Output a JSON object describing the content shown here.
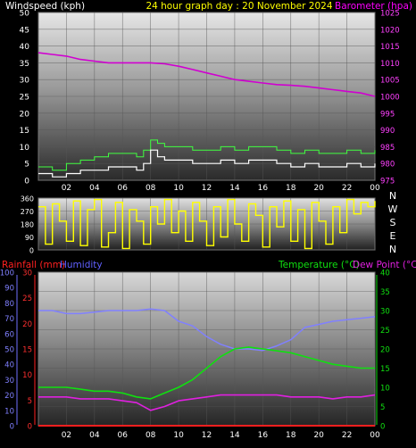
{
  "header": {
    "wind_label": "Windspeed (kph)",
    "title": "24 hour graph day : 20 November 2024",
    "baro_label": "Barometer (hpa)"
  },
  "panel2": {
    "compass": [
      "N",
      "W",
      "S",
      "E",
      "N"
    ]
  },
  "panel3": {
    "rain_label": "Rainfall (mm)",
    "humidity_label": "Humidity",
    "temp_label": "Temperature (°C)",
    "dew_label": "Dew Point (°C)"
  },
  "colors": {
    "wind": "#ffffff",
    "gust": "#40ff40",
    "barometer": "#d000d0",
    "direction": "#ffff00",
    "rain": "#ff2020",
    "humidity": "#8080ff",
    "temperature": "#10e010",
    "dewpoint": "#e020e0",
    "title": "#ffff00"
  },
  "chart_data": [
    {
      "type": "line",
      "title": "24 hour graph day : 20 November 2024",
      "x_ticks": [
        "02",
        "04",
        "06",
        "08",
        "10",
        "12",
        "14",
        "16",
        "18",
        "20",
        "22",
        "00"
      ],
      "xlim": [
        0,
        24
      ],
      "y_left": {
        "label": "Windspeed (kph)",
        "ylim": [
          0,
          50
        ],
        "ticks": [
          "0",
          "5",
          "10",
          "15",
          "20",
          "25",
          "30",
          "35",
          "40",
          "45",
          "50"
        ]
      },
      "y_right": {
        "label": "Barometer (hpa)",
        "ylim": [
          975,
          1025
        ],
        "ticks": [
          "975",
          "980",
          "985",
          "990",
          "995",
          "1000",
          "1005",
          "1010",
          "1015",
          "1020",
          "1025"
        ]
      },
      "series": [
        {
          "name": "Windspeed (kph)",
          "axis": "left",
          "x": [
            0,
            1,
            2,
            3,
            4,
            5,
            6,
            7,
            7.5,
            8,
            8.5,
            9,
            10,
            11,
            12,
            13,
            14,
            15,
            16,
            17,
            18,
            19,
            20,
            21,
            22,
            23,
            24
          ],
          "values": [
            2,
            1,
            2,
            3,
            3,
            4,
            4,
            3,
            5,
            9,
            7,
            6,
            6,
            5,
            5,
            6,
            5,
            6,
            6,
            5,
            4,
            5,
            4,
            4,
            5,
            4,
            5
          ]
        },
        {
          "name": "Gust",
          "axis": "left",
          "x": [
            0,
            1,
            2,
            3,
            4,
            5,
            6,
            7,
            7.5,
            8,
            8.5,
            9,
            10,
            11,
            12,
            13,
            14,
            15,
            16,
            17,
            18,
            19,
            20,
            21,
            22,
            23,
            24
          ],
          "values": [
            4,
            3,
            5,
            6,
            7,
            8,
            8,
            7,
            9,
            12,
            11,
            10,
            10,
            9,
            9,
            10,
            9,
            10,
            10,
            9,
            8,
            9,
            8,
            8,
            9,
            8,
            9
          ]
        },
        {
          "name": "Barometer (hpa)",
          "axis": "right",
          "x": [
            0,
            1,
            2,
            3,
            4,
            5,
            6,
            7,
            8,
            9,
            10,
            11,
            12,
            13,
            14,
            15,
            16,
            17,
            18,
            19,
            20,
            21,
            22,
            23,
            24
          ],
          "values": [
            1013,
            1012.5,
            1012,
            1011,
            1010.5,
            1010,
            1010,
            1010,
            1010,
            1009.7,
            1009,
            1008,
            1007,
            1006,
            1005,
            1004.5,
            1004,
            1003.5,
            1003.3,
            1003,
            1002.5,
            1002,
            1001.5,
            1001,
            1000
          ]
        }
      ]
    },
    {
      "type": "line",
      "x_ticks": [
        "02",
        "04",
        "06",
        "08",
        "10",
        "12",
        "14",
        "16",
        "18",
        "20",
        "22",
        "00"
      ],
      "xlim": [
        0,
        24
      ],
      "y_left": {
        "ylim": [
          0,
          360
        ],
        "ticks": [
          "0",
          "90",
          "180",
          "270",
          "360"
        ]
      },
      "series": [
        {
          "name": "Wind direction",
          "axis": "left",
          "x": [
            0,
            0.5,
            1,
            1.5,
            2,
            2.5,
            3,
            3.5,
            4,
            4.5,
            5,
            5.5,
            6,
            6.5,
            7,
            7.5,
            8,
            8.5,
            9,
            9.5,
            10,
            10.5,
            11,
            11.5,
            12,
            12.5,
            13,
            13.5,
            14,
            14.5,
            15,
            15.5,
            16,
            16.5,
            17,
            17.5,
            18,
            18.5,
            19,
            19.5,
            20,
            20.5,
            21,
            21.5,
            22,
            22.5,
            23,
            23.5,
            24
          ],
          "values": [
            300,
            40,
            320,
            200,
            60,
            340,
            30,
            280,
            350,
            20,
            120,
            330,
            10,
            280,
            200,
            40,
            300,
            180,
            350,
            120,
            270,
            60,
            330,
            200,
            30,
            300,
            90,
            350,
            180,
            60,
            320,
            240,
            20,
            300,
            160,
            340,
            60,
            280,
            10,
            330,
            200,
            40,
            300,
            120,
            350,
            250,
            330,
            300,
            340
          ]
        }
      ]
    },
    {
      "type": "line",
      "x_ticks": [
        "02",
        "04",
        "06",
        "08",
        "10",
        "12",
        "14",
        "16",
        "18",
        "20",
        "22",
        "00"
      ],
      "xlim": [
        0,
        24
      ],
      "y_left": {
        "label": "Humidity",
        "ylim": [
          0,
          100
        ],
        "ticks": [
          "0",
          "10",
          "20",
          "30",
          "40",
          "50",
          "60",
          "70",
          "80",
          "90",
          "100"
        ]
      },
      "y_left2": {
        "label": "Rainfall (mm)",
        "ylim": [
          0,
          30
        ],
        "ticks": [
          "0",
          "5",
          "10",
          "15",
          "20",
          "25",
          "30"
        ]
      },
      "y_right": {
        "label": "Temperature (°C)",
        "ylim": [
          0,
          40
        ],
        "ticks": [
          "0",
          "5",
          "10",
          "15",
          "20",
          "25",
          "30",
          "35",
          "40"
        ]
      },
      "series": [
        {
          "name": "Humidity",
          "axis": "left",
          "x": [
            0,
            1,
            2,
            3,
            4,
            5,
            6,
            7,
            8,
            9,
            10,
            11,
            12,
            13,
            14,
            15,
            16,
            17,
            18,
            19,
            20,
            21,
            22,
            23,
            24
          ],
          "values": [
            75,
            75,
            73,
            73,
            74,
            75,
            75,
            75,
            76,
            75,
            68,
            65,
            58,
            53,
            50,
            50,
            49,
            52,
            56,
            64,
            66,
            68,
            69,
            70,
            71
          ]
        },
        {
          "name": "Rainfall (mm)",
          "axis": "left2",
          "x": [
            0,
            24
          ],
          "values": [
            0,
            0
          ]
        },
        {
          "name": "Temperature (°C)",
          "axis": "right",
          "x": [
            0,
            1,
            2,
            3,
            4,
            5,
            6,
            7,
            8,
            9,
            10,
            11,
            12,
            13,
            14,
            15,
            16,
            17,
            18,
            19,
            20,
            21,
            22,
            23,
            24
          ],
          "values": [
            10,
            10,
            10,
            9.5,
            9,
            9,
            8.5,
            7.5,
            7,
            8.5,
            10,
            12,
            15,
            18,
            20,
            20.5,
            20,
            19.5,
            19,
            18,
            17,
            16,
            15.5,
            15,
            15
          ]
        },
        {
          "name": "Dew Point (°C)",
          "axis": "right",
          "x": [
            0,
            1,
            2,
            3,
            4,
            5,
            6,
            7,
            8,
            9,
            10,
            11,
            12,
            13,
            14,
            15,
            16,
            17,
            18,
            19,
            20,
            21,
            22,
            23,
            24
          ],
          "values": [
            7.5,
            7.5,
            7.5,
            7,
            7,
            7,
            6.5,
            6,
            4,
            5,
            6.5,
            7,
            7.5,
            8,
            8,
            8,
            8,
            8,
            7.5,
            7.5,
            7.5,
            7,
            7.5,
            7.5,
            8
          ]
        }
      ]
    }
  ]
}
